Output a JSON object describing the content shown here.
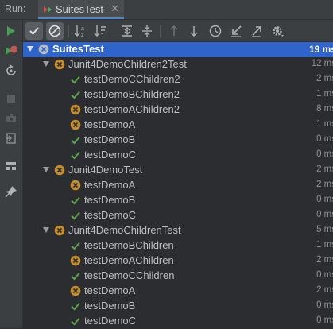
{
  "run_label": "Run:",
  "tab": {
    "title": "SuitesTest",
    "close": "✕"
  },
  "colors": {
    "pass": "#5fa04e",
    "fail": "#c28c2f",
    "selection": "#2f65ca",
    "accent": "#4a88c7"
  },
  "left_toolbar": [
    {
      "name": "rerun-icon"
    },
    {
      "name": "rerun-failed-icon"
    },
    {
      "name": "toggle-auto-test-icon"
    },
    {
      "name": "stop-icon"
    },
    {
      "name": "camera-icon"
    },
    {
      "name": "exit-icon"
    },
    {
      "name": "layout-icon"
    },
    {
      "name": "pin-icon"
    }
  ],
  "top_toolbar": [
    {
      "name": "show-passed-icon",
      "toggled": true
    },
    {
      "name": "show-ignored-icon",
      "toggled": true
    },
    {
      "name": "sort-alphabetically-icon"
    },
    {
      "name": "sort-by-duration-icon"
    },
    {
      "name": "expand-all-icon"
    },
    {
      "name": "collapse-all-icon"
    },
    {
      "name": "previous-failed-icon"
    },
    {
      "name": "next-failed-icon"
    },
    {
      "name": "test-history-icon"
    },
    {
      "name": "import-tests-icon"
    },
    {
      "name": "export-results-icon"
    },
    {
      "name": "settings-icon"
    }
  ],
  "tree": [
    {
      "label": "SuitesTest",
      "time": "19 ms",
      "status": "fail",
      "level": 0,
      "expanded": true,
      "selected": true,
      "root": true
    },
    {
      "label": "Junit4DemoChildren2Test",
      "time": "12 ms",
      "status": "fail",
      "level": 1,
      "expanded": true
    },
    {
      "label": "testDemoCChildren2",
      "time": "2 ms",
      "status": "pass",
      "level": 2
    },
    {
      "label": "testDemoBChildren2",
      "time": "1 ms",
      "status": "pass",
      "level": 2
    },
    {
      "label": "testDemoAChildren2",
      "time": "8 ms",
      "status": "fail",
      "level": 2
    },
    {
      "label": "testDemoA",
      "time": "1 ms",
      "status": "fail",
      "level": 2
    },
    {
      "label": "testDemoB",
      "time": "0 ms",
      "status": "pass",
      "level": 2
    },
    {
      "label": "testDemoC",
      "time": "0 ms",
      "status": "pass",
      "level": 2
    },
    {
      "label": "Junit4DemoTest",
      "time": "2 ms",
      "status": "fail",
      "level": 1,
      "expanded": true
    },
    {
      "label": "testDemoA",
      "time": "2 ms",
      "status": "fail",
      "level": 2
    },
    {
      "label": "testDemoB",
      "time": "0 ms",
      "status": "pass",
      "level": 2
    },
    {
      "label": "testDemoC",
      "time": "0 ms",
      "status": "pass",
      "level": 2
    },
    {
      "label": "Junit4DemoChildrenTest",
      "time": "5 ms",
      "status": "fail",
      "level": 1,
      "expanded": true
    },
    {
      "label": "testDemoBChildren",
      "time": "1 ms",
      "status": "pass",
      "level": 2
    },
    {
      "label": "testDemoAChildren",
      "time": "2 ms",
      "status": "fail",
      "level": 2
    },
    {
      "label": "testDemoCChildren",
      "time": "0 ms",
      "status": "pass",
      "level": 2
    },
    {
      "label": "testDemoA",
      "time": "2 ms",
      "status": "fail",
      "level": 2
    },
    {
      "label": "testDemoB",
      "time": "0 ms",
      "status": "pass",
      "level": 2
    },
    {
      "label": "testDemoC",
      "time": "0 ms",
      "status": "pass",
      "level": 2
    }
  ]
}
